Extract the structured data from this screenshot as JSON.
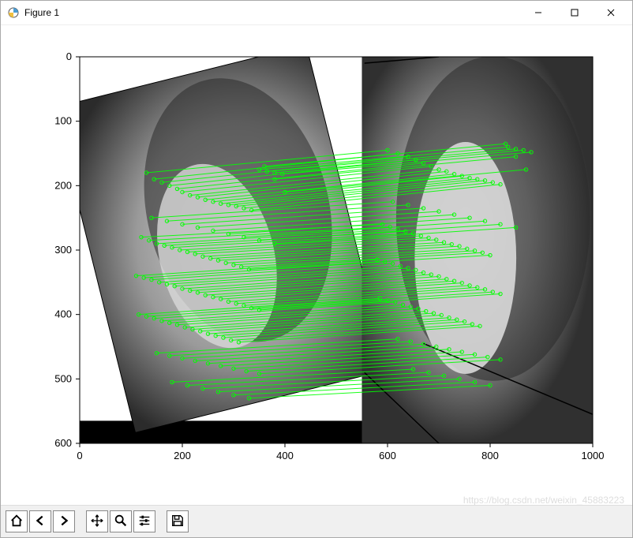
{
  "window": {
    "title": "Figure 1"
  },
  "watermark": "https://blog.csdn.net/weixin_45883223",
  "toolbar": {
    "items": [
      "home",
      "back",
      "forward",
      "pan",
      "zoom",
      "configure",
      "save"
    ]
  },
  "chart_data": {
    "type": "scatter",
    "title": "",
    "xlabel": "",
    "ylabel": "",
    "xlim": [
      0,
      1000
    ],
    "ylim": [
      600,
      0
    ],
    "xticks": [
      0,
      200,
      400,
      600,
      800,
      1000
    ],
    "yticks": [
      0,
      100,
      200,
      300,
      400,
      500,
      600
    ],
    "description": "Feature-matching visualization: left panel shows a rotated grayscale portrait, right panel shows the original portrait; green lines connect corresponding keypoints between the two images.",
    "image_panels": [
      {
        "name": "left (rotated)",
        "x_range": [
          0,
          550
        ],
        "y_range": [
          0,
          600
        ]
      },
      {
        "name": "right (original)",
        "x_range": [
          550,
          1000
        ],
        "y_range": [
          0,
          600
        ]
      }
    ],
    "matches": [
      {
        "x1": 130,
        "y1": 180,
        "x2": 600,
        "y2": 145
      },
      {
        "x1": 145,
        "y1": 190,
        "x2": 620,
        "y2": 150
      },
      {
        "x1": 160,
        "y1": 195,
        "x2": 640,
        "y2": 155
      },
      {
        "x1": 175,
        "y1": 200,
        "x2": 655,
        "y2": 160
      },
      {
        "x1": 190,
        "y1": 205,
        "x2": 670,
        "y2": 165
      },
      {
        "x1": 200,
        "y1": 210,
        "x2": 685,
        "y2": 170
      },
      {
        "x1": 215,
        "y1": 215,
        "x2": 700,
        "y2": 175
      },
      {
        "x1": 230,
        "y1": 218,
        "x2": 715,
        "y2": 178
      },
      {
        "x1": 245,
        "y1": 222,
        "x2": 730,
        "y2": 182
      },
      {
        "x1": 260,
        "y1": 225,
        "x2": 745,
        "y2": 185
      },
      {
        "x1": 275,
        "y1": 228,
        "x2": 760,
        "y2": 188
      },
      {
        "x1": 290,
        "y1": 230,
        "x2": 775,
        "y2": 190
      },
      {
        "x1": 305,
        "y1": 232,
        "x2": 790,
        "y2": 192
      },
      {
        "x1": 320,
        "y1": 235,
        "x2": 805,
        "y2": 195
      },
      {
        "x1": 335,
        "y1": 238,
        "x2": 820,
        "y2": 198
      },
      {
        "x1": 350,
        "y1": 175,
        "x2": 835,
        "y2": 140
      },
      {
        "x1": 365,
        "y1": 178,
        "x2": 850,
        "y2": 143
      },
      {
        "x1": 380,
        "y1": 180,
        "x2": 865,
        "y2": 145
      },
      {
        "x1": 395,
        "y1": 182,
        "x2": 880,
        "y2": 148
      },
      {
        "x1": 120,
        "y1": 280,
        "x2": 590,
        "y2": 260
      },
      {
        "x1": 135,
        "y1": 285,
        "x2": 605,
        "y2": 264
      },
      {
        "x1": 150,
        "y1": 290,
        "x2": 620,
        "y2": 268
      },
      {
        "x1": 165,
        "y1": 293,
        "x2": 635,
        "y2": 271
      },
      {
        "x1": 180,
        "y1": 296,
        "x2": 650,
        "y2": 274
      },
      {
        "x1": 195,
        "y1": 300,
        "x2": 665,
        "y2": 278
      },
      {
        "x1": 210,
        "y1": 303,
        "x2": 680,
        "y2": 281
      },
      {
        "x1": 225,
        "y1": 306,
        "x2": 695,
        "y2": 284
      },
      {
        "x1": 240,
        "y1": 310,
        "x2": 710,
        "y2": 288
      },
      {
        "x1": 255,
        "y1": 313,
        "x2": 725,
        "y2": 291
      },
      {
        "x1": 270,
        "y1": 316,
        "x2": 740,
        "y2": 294
      },
      {
        "x1": 285,
        "y1": 320,
        "x2": 755,
        "y2": 298
      },
      {
        "x1": 300,
        "y1": 323,
        "x2": 770,
        "y2": 301
      },
      {
        "x1": 315,
        "y1": 326,
        "x2": 785,
        "y2": 304
      },
      {
        "x1": 330,
        "y1": 330,
        "x2": 800,
        "y2": 308
      },
      {
        "x1": 110,
        "y1": 340,
        "x2": 580,
        "y2": 315
      },
      {
        "x1": 125,
        "y1": 343,
        "x2": 595,
        "y2": 318
      },
      {
        "x1": 140,
        "y1": 346,
        "x2": 610,
        "y2": 321
      },
      {
        "x1": 155,
        "y1": 350,
        "x2": 625,
        "y2": 325
      },
      {
        "x1": 170,
        "y1": 353,
        "x2": 640,
        "y2": 328
      },
      {
        "x1": 185,
        "y1": 356,
        "x2": 655,
        "y2": 331
      },
      {
        "x1": 200,
        "y1": 360,
        "x2": 670,
        "y2": 335
      },
      {
        "x1": 215,
        "y1": 363,
        "x2": 685,
        "y2": 338
      },
      {
        "x1": 230,
        "y1": 366,
        "x2": 700,
        "y2": 341
      },
      {
        "x1": 245,
        "y1": 370,
        "x2": 715,
        "y2": 345
      },
      {
        "x1": 260,
        "y1": 373,
        "x2": 730,
        "y2": 348
      },
      {
        "x1": 275,
        "y1": 376,
        "x2": 745,
        "y2": 351
      },
      {
        "x1": 290,
        "y1": 380,
        "x2": 760,
        "y2": 355
      },
      {
        "x1": 305,
        "y1": 383,
        "x2": 775,
        "y2": 358
      },
      {
        "x1": 320,
        "y1": 386,
        "x2": 790,
        "y2": 361
      },
      {
        "x1": 335,
        "y1": 390,
        "x2": 805,
        "y2": 365
      },
      {
        "x1": 350,
        "y1": 393,
        "x2": 820,
        "y2": 368
      },
      {
        "x1": 115,
        "y1": 400,
        "x2": 585,
        "y2": 375
      },
      {
        "x1": 130,
        "y1": 403,
        "x2": 600,
        "y2": 378
      },
      {
        "x1": 145,
        "y1": 406,
        "x2": 615,
        "y2": 381
      },
      {
        "x1": 160,
        "y1": 410,
        "x2": 630,
        "y2": 385
      },
      {
        "x1": 175,
        "y1": 413,
        "x2": 645,
        "y2": 388
      },
      {
        "x1": 190,
        "y1": 416,
        "x2": 660,
        "y2": 391
      },
      {
        "x1": 205,
        "y1": 420,
        "x2": 675,
        "y2": 395
      },
      {
        "x1": 220,
        "y1": 423,
        "x2": 690,
        "y2": 398
      },
      {
        "x1": 235,
        "y1": 426,
        "x2": 705,
        "y2": 401
      },
      {
        "x1": 250,
        "y1": 430,
        "x2": 720,
        "y2": 405
      },
      {
        "x1": 265,
        "y1": 433,
        "x2": 735,
        "y2": 408
      },
      {
        "x1": 280,
        "y1": 436,
        "x2": 750,
        "y2": 411
      },
      {
        "x1": 295,
        "y1": 440,
        "x2": 765,
        "y2": 415
      },
      {
        "x1": 310,
        "y1": 443,
        "x2": 780,
        "y2": 418
      },
      {
        "x1": 150,
        "y1": 460,
        "x2": 620,
        "y2": 438
      },
      {
        "x1": 175,
        "y1": 464,
        "x2": 645,
        "y2": 442
      },
      {
        "x1": 200,
        "y1": 468,
        "x2": 670,
        "y2": 446
      },
      {
        "x1": 225,
        "y1": 472,
        "x2": 695,
        "y2": 450
      },
      {
        "x1": 250,
        "y1": 476,
        "x2": 720,
        "y2": 454
      },
      {
        "x1": 275,
        "y1": 480,
        "x2": 745,
        "y2": 458
      },
      {
        "x1": 300,
        "y1": 484,
        "x2": 770,
        "y2": 462
      },
      {
        "x1": 325,
        "y1": 488,
        "x2": 795,
        "y2": 466
      },
      {
        "x1": 350,
        "y1": 492,
        "x2": 820,
        "y2": 470
      },
      {
        "x1": 180,
        "y1": 505,
        "x2": 650,
        "y2": 485
      },
      {
        "x1": 210,
        "y1": 510,
        "x2": 680,
        "y2": 490
      },
      {
        "x1": 240,
        "y1": 515,
        "x2": 710,
        "y2": 495
      },
      {
        "x1": 270,
        "y1": 520,
        "x2": 740,
        "y2": 500
      },
      {
        "x1": 300,
        "y1": 525,
        "x2": 770,
        "y2": 505
      },
      {
        "x1": 330,
        "y1": 530,
        "x2": 800,
        "y2": 510
      },
      {
        "x1": 360,
        "y1": 170,
        "x2": 830,
        "y2": 135
      },
      {
        "x1": 380,
        "y1": 190,
        "x2": 850,
        "y2": 155
      },
      {
        "x1": 400,
        "y1": 210,
        "x2": 870,
        "y2": 175
      },
      {
        "x1": 140,
        "y1": 250,
        "x2": 610,
        "y2": 225
      },
      {
        "x1": 170,
        "y1": 255,
        "x2": 640,
        "y2": 230
      },
      {
        "x1": 200,
        "y1": 260,
        "x2": 670,
        "y2": 235
      },
      {
        "x1": 230,
        "y1": 265,
        "x2": 700,
        "y2": 240
      },
      {
        "x1": 260,
        "y1": 270,
        "x2": 730,
        "y2": 245
      },
      {
        "x1": 290,
        "y1": 275,
        "x2": 760,
        "y2": 250
      },
      {
        "x1": 320,
        "y1": 280,
        "x2": 790,
        "y2": 255
      },
      {
        "x1": 350,
        "y1": 285,
        "x2": 820,
        "y2": 260
      },
      {
        "x1": 380,
        "y1": 290,
        "x2": 850,
        "y2": 265
      }
    ],
    "match_line_color": "#00ff00"
  }
}
